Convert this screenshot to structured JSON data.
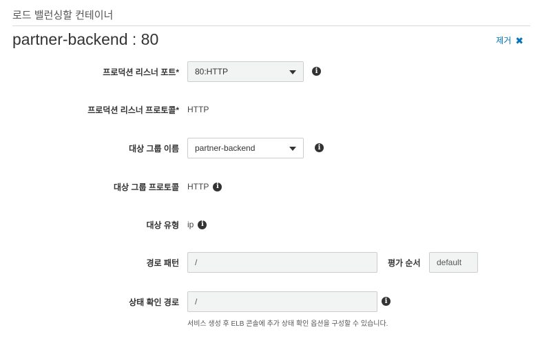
{
  "section": {
    "title": "로드 밸런싱할 컨테이너"
  },
  "container": {
    "heading": "partner-backend : 80",
    "remove_label": "제거",
    "remove_icon": "close-icon"
  },
  "fields": {
    "listener_port": {
      "label": "프로덕션 리스너 포트*",
      "value": "80:HTTP"
    },
    "listener_protocol": {
      "label": "프로덕션 리스너 프로토콜*",
      "value": "HTTP"
    },
    "target_group_name": {
      "label": "대상 그룹 이름",
      "value": "partner-backend"
    },
    "target_group_protocol": {
      "label": "대상 그룹 프로토콜",
      "value": "HTTP"
    },
    "target_type": {
      "label": "대상 유형",
      "value": "ip"
    },
    "path_pattern": {
      "label": "경로 패턴",
      "value": "/"
    },
    "evaluation_order": {
      "label": "평가 순서",
      "value": "default"
    },
    "health_check_path": {
      "label": "상태 확인 경로",
      "value": "/",
      "help": "서비스 생성 후 ELB 콘솔에 추가 상태 확인 옵션을 구성할 수 있습니다."
    }
  },
  "icons": {
    "info": "i"
  },
  "colors": {
    "link": "#0073bb",
    "input_bg": "#f2f3f3",
    "border": "#cccccc"
  }
}
